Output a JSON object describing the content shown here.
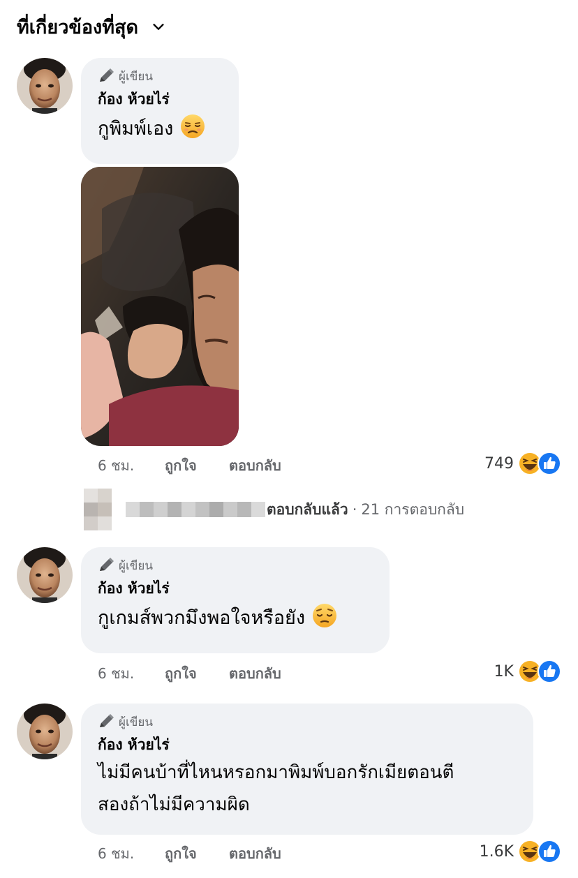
{
  "sort": {
    "label": "ที่เกี่ยวข้องที่สุด",
    "icon": "chevron-down-icon"
  },
  "comments": [
    {
      "badge": "ผู้เขียน",
      "author": "ก้อง ห้วยไร่",
      "text": "กูพิมพ์เอง",
      "emoji": "unamused-face-emoji",
      "has_photo": true,
      "time": "6 ชม.",
      "like_label": "ถูกใจ",
      "reply_label": "ตอบกลับ",
      "reaction_count": "749",
      "reactions": [
        "haha",
        "like"
      ]
    },
    {
      "badge": "ผู้เขียน",
      "author": "ก้อง ห้วยไร่",
      "text": "กูเกมส์พวกมึงพอใจหรือยัง",
      "emoji": "pensive-face-emoji",
      "time": "6 ชม.",
      "like_label": "ถูกใจ",
      "reply_label": "ตอบกลับ",
      "reaction_count": "1K",
      "reactions": [
        "haha",
        "like"
      ]
    },
    {
      "badge": "ผู้เขียน",
      "author": "ก้อง ห้วยไร่",
      "text": "ไม่มีคนบ้าที่ไหนหรอกมาพิมพ์บอกรักเมียตอนตี\nสองถ้าไม่มีความผิด",
      "time": "6 ชม.",
      "like_label": "ถูกใจ",
      "reply_label": "ตอบกลับ",
      "reaction_count": "1.6K",
      "reactions": [
        "haha",
        "like"
      ]
    }
  ],
  "replies_summary": {
    "replied_label": "ตอบกลับแล้ว",
    "separator": "·",
    "count_label": "21 การตอบกลับ"
  },
  "colors": {
    "bubble": "#f0f2f5",
    "secondary_text": "#65676b",
    "like_blue": "#1877f2",
    "haha_yellow": "#f7b125"
  }
}
